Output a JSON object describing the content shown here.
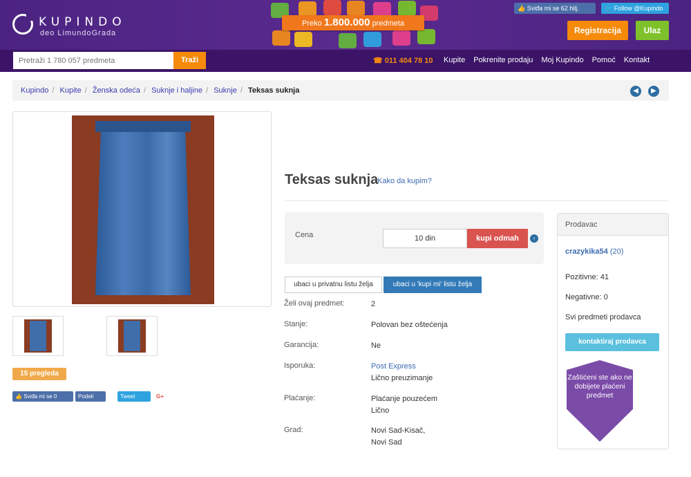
{
  "header": {
    "logo_name": "KUPINDO",
    "logo_sub": "deo LimundoGrada",
    "promo_prefix": "Preko",
    "promo_number": "1.800.000",
    "promo_suffix": "predmeta",
    "fb_top": "Sviđa mi se 62 hilj.",
    "tw_top": "Follow @Kupindo",
    "register": "Registracija",
    "login": "Ulaz"
  },
  "nav": {
    "search_placeholder": "Pretraži 1 780 057 predmeta",
    "search_button": "Traži",
    "phone": "☎ 011 404 78 10",
    "links": [
      "Kupite",
      "Pokrenite prodaju",
      "Moj Kupindo",
      "Pomoć",
      "Kontakt"
    ]
  },
  "breadcrumb": [
    "Kupindo",
    "Kupite",
    "Ženska odeća",
    "Suknje i haljine",
    "Suknje",
    "Teksas suknja"
  ],
  "product": {
    "title": "Teksas suknja",
    "how_buy": "Kako da kupim?",
    "price_label": "Cena",
    "price_value": "10 din",
    "buy_button": "kupi odmah",
    "wishlist_private": "ubaci u privatnu listu želja",
    "wishlist_public": "ubaci u 'kupi mi' listu želja",
    "views_badge": "15 pregleda",
    "details": [
      {
        "label": "Želi ovaj predmet:",
        "value": "2"
      },
      {
        "label": "Stanje:",
        "value": "Polovan bez oštećenja"
      },
      {
        "label": "Garancija:",
        "value": "Ne"
      },
      {
        "label": "Isporuka:",
        "value": "Post Express",
        "value2": "Lično preuzimanje"
      },
      {
        "label": "Plaćanje:",
        "value": "Plaćanje pouzećem",
        "value2": "Lično"
      },
      {
        "label": "Grad:",
        "value": "Novi Sad-Kisač,",
        "value2": "Novi Sad"
      }
    ]
  },
  "share": {
    "fb": "Sviđa mi se 0",
    "fb_share": "Podeli",
    "tweet": "Tweet",
    "gplus": "G+"
  },
  "seller": {
    "heading": "Prodavac",
    "name": "crazykika54",
    "count": "(20)",
    "positive": "Pozitivne: 41",
    "negative": "Negativne: 0",
    "all_items": "Svi predmeti prodavca",
    "contact": "kontaktiraj prodavca",
    "shield_text": "Zaštićeni ste ako ne dobijete plaćeni predmet"
  },
  "colors": {
    "header_purple": "#4b2381",
    "nav_purple": "#3b1467",
    "orange": "#f58a0b",
    "green": "#7ec12a",
    "red": "#d9534f",
    "blue": "#337ab7"
  }
}
